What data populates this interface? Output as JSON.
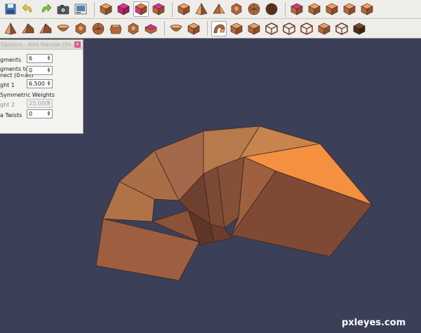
{
  "options_panel": {
    "title": "Options - Add Handle (Sh...",
    "close_glyph": "x",
    "fields": [
      {
        "label": "gments",
        "value": "6"
      },
      {
        "label": "gments to",
        "label2": "nect (0=all)",
        "value": "0"
      },
      {
        "label": "ght 1",
        "value": "6.500"
      },
      {
        "label": "Symmetric Weights",
        "type": "checkbox"
      },
      {
        "label": "ght 2",
        "value": "25.000",
        "disabled": true
      },
      {
        "label": "a Twists",
        "value": "0"
      }
    ]
  },
  "toolbar_top": {
    "groups": [
      [
        "save-icon",
        "undo-icon",
        "redo-icon",
        "camera-icon",
        "render-view-icon"
      ],
      [
        "cube-icon",
        "cube-magenta-icon",
        "cube-select-icon",
        "cube-magenta-face-icon"
      ],
      [
        "box-icon",
        "pyramid-icon",
        "tetrahedron-icon",
        "dodecahedron-icon",
        "soccer-ball-icon",
        "sphere-icon"
      ],
      [
        "cube-magenta-top-icon",
        "cube-orange-icon",
        "cube-split-icon",
        "cube-plain-icon",
        "cube-stack-icon"
      ]
    ],
    "active": [
      "cube-select-icon"
    ]
  },
  "toolbar_bottom": {
    "groups": [
      [
        "cone-icon",
        "wedge-icon",
        "star-prism-icon",
        "bowl-icon",
        "gem-icon",
        "lattice-ball-icon",
        "hex-prism-icon",
        "gem-round-icon",
        "magenta-cushion-icon"
      ],
      [
        "curved-arch-icon",
        "twisted-cube-icon"
      ],
      [
        "spiral-handle-icon",
        "cube-recess-icon",
        "bump-cube-icon",
        "wire-cube-icon",
        "cage-cube-icon",
        "cross-cube-icon",
        "bevel-cube-icon",
        "hollow-cube-icon",
        "dark-cube-icon"
      ]
    ],
    "active": [
      "spiral-handle-icon"
    ]
  },
  "colors": {
    "viewport_bg": "#3b3f57",
    "mesh_light": "#f4903f",
    "mesh_mid": "#c47a4c",
    "mesh_dark": "#7e4a36"
  },
  "watermark": "pxleyes.com"
}
